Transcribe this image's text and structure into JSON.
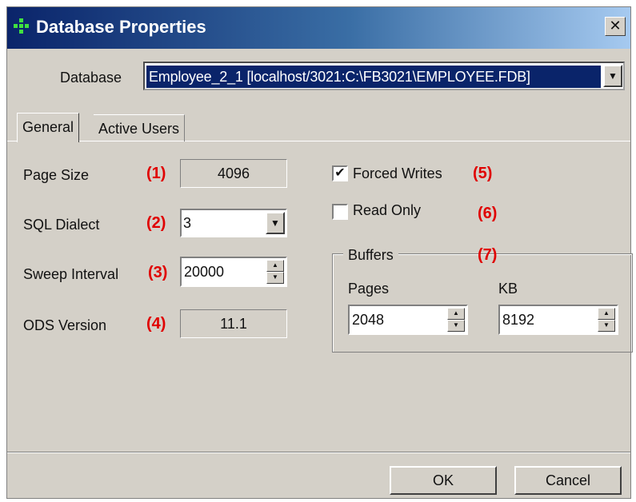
{
  "window": {
    "title": "Database Properties",
    "close_glyph": "✕"
  },
  "database": {
    "label": "Database",
    "selected": "Employee_2_1 [localhost/3021:C:\\FB3021\\EMPLOYEE.FDB]"
  },
  "tabs": [
    {
      "label": "General",
      "active": true
    },
    {
      "label": "Active Users",
      "active": false
    }
  ],
  "general": {
    "page_size": {
      "label": "Page Size",
      "marker": "(1)",
      "value": "4096"
    },
    "sql_dialect": {
      "label": "SQL Dialect",
      "marker": "(2)",
      "value": "3"
    },
    "sweep_interval": {
      "label": "Sweep Interval",
      "marker": "(3)",
      "value": "20000"
    },
    "ods_version": {
      "label": "ODS Version",
      "marker": "(4)",
      "value": "11.1"
    },
    "forced_writes": {
      "label": "Forced Writes",
      "marker": "(5)",
      "checked": true
    },
    "read_only": {
      "label": "Read Only",
      "marker": "(6)",
      "checked": false
    },
    "buffers": {
      "title": "Buffers",
      "marker": "(7)",
      "pages_label": "Pages",
      "pages_value": "2048",
      "kb_label": "KB",
      "kb_value": "8192"
    }
  },
  "buttons": {
    "ok": "OK",
    "cancel": "Cancel"
  },
  "glyphs": {
    "checkmark": "✔",
    "dropdown": "▼",
    "spin_up": "▲",
    "spin_down": "▼"
  },
  "colors": {
    "title_gradient_start": "#0a246a",
    "title_gradient_end": "#a6caf0",
    "marker_red": "#e00000",
    "window_bg": "#d4d0c8",
    "selection_bg": "#0a246a"
  }
}
